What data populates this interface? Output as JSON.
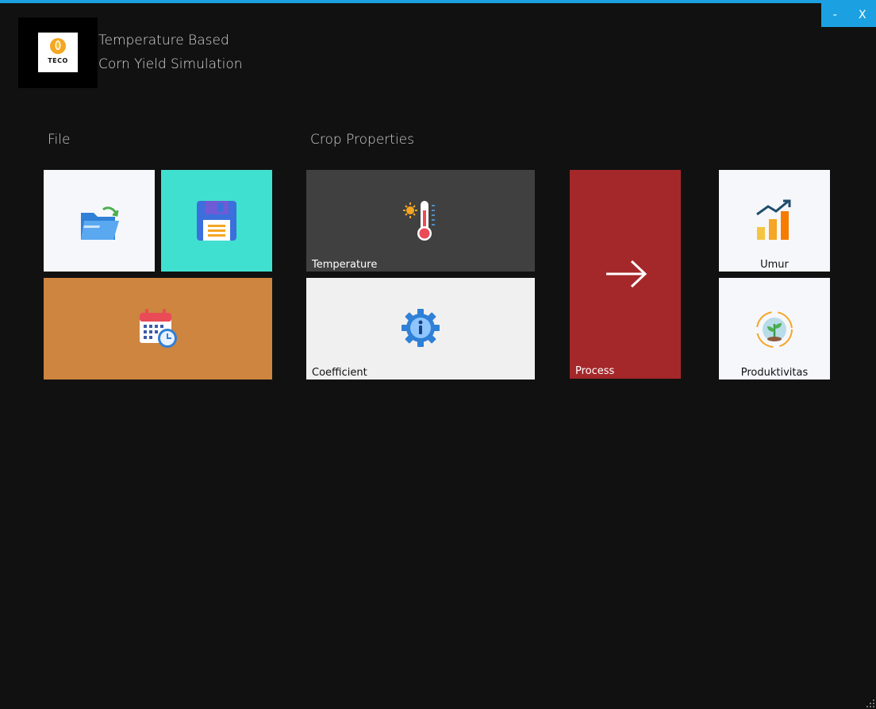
{
  "window": {
    "minimize_label": "-",
    "close_label": "X",
    "accent_color": "#1ba1e2"
  },
  "app": {
    "logo_text": "TECO",
    "title_line1": "Temperature Based",
    "title_line2": "Corn Yield Simulation"
  },
  "groups": {
    "file_label": "File",
    "crop_label": "Crop Properties"
  },
  "tiles": {
    "open": {
      "icon": "open-folder-icon",
      "color": "#f6f7fb"
    },
    "save": {
      "icon": "floppy-disk-icon",
      "color": "#40e0d0"
    },
    "calendar": {
      "icon": "calendar-clock-icon",
      "color": "#cd853f"
    },
    "temperature": {
      "label": "Temperature",
      "icon": "thermometer-icon",
      "color": "#404040"
    },
    "coefficient": {
      "label": "Coefficient",
      "icon": "gear-info-icon",
      "color": "#f0f0f0"
    },
    "process": {
      "label": "Process",
      "icon": "arrow-right-icon",
      "color": "#a4282a"
    },
    "umur": {
      "label": "Umur",
      "icon": "growth-chart-icon",
      "color": "#f6f7fb"
    },
    "produktivitas": {
      "label": "Produktivitas",
      "icon": "plant-cycle-icon",
      "color": "#f6f7fb"
    }
  }
}
